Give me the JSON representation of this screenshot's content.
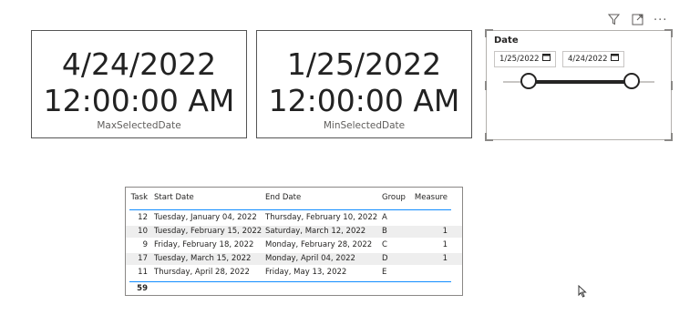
{
  "cards": [
    {
      "date": "4/24/2022",
      "time": "12:00:00 AM",
      "label": "MaxSelectedDate"
    },
    {
      "date": "1/25/2022",
      "time": "12:00:00 AM",
      "label": "MinSelectedDate"
    }
  ],
  "visual_header": {
    "filter_icon": "filter-icon",
    "focus_icon": "focus-mode-icon",
    "more_icon": "more-options-icon"
  },
  "slicer": {
    "title": "Date",
    "start_date": "1/25/2022",
    "end_date": "4/24/2022",
    "calendar_icon": "calendar-icon"
  },
  "table": {
    "headers": [
      "Task",
      "Start Date",
      "End Date",
      "Group",
      "Measure"
    ],
    "rows": [
      {
        "task": "12",
        "start": "Tuesday, January 04, 2022",
        "end": "Thursday, February 10, 2022",
        "group": "A",
        "measure": ""
      },
      {
        "task": "10",
        "start": "Tuesday, February 15, 2022",
        "end": "Saturday, March 12, 2022",
        "group": "B",
        "measure": "1"
      },
      {
        "task": "9",
        "start": "Friday, February 18, 2022",
        "end": "Monday, February 28, 2022",
        "group": "C",
        "measure": "1"
      },
      {
        "task": "17",
        "start": "Tuesday, March 15, 2022",
        "end": "Monday, April 04, 2022",
        "group": "D",
        "measure": "1"
      },
      {
        "task": "11",
        "start": "Thursday, April 28, 2022",
        "end": "Friday, May 13, 2022",
        "group": "E",
        "measure": ""
      }
    ],
    "total": "59"
  },
  "colors": {
    "accent": "#118dff",
    "text": "#252423",
    "alt_row": "#eeeeee"
  }
}
